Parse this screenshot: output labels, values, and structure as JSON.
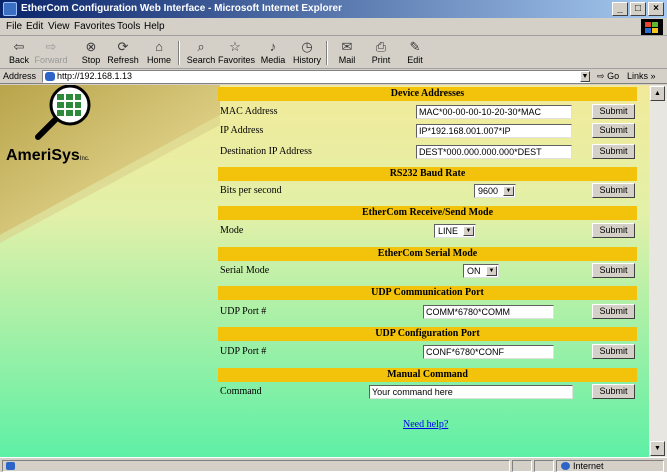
{
  "window": {
    "title": "EtherCom Configuration Web Interface - Microsoft Internet Explorer"
  },
  "menu": [
    "File",
    "Edit",
    "View",
    "Favorites",
    "Tools",
    "Help"
  ],
  "toolbar": {
    "back": "Back",
    "forward": "Forward",
    "stop": "Stop",
    "refresh": "Refresh",
    "home": "Home",
    "search": "Search",
    "favorites": "Favorites",
    "media": "Media",
    "history": "History",
    "mail": "Mail",
    "print": "Print",
    "edit": "Edit"
  },
  "address": {
    "label": "Address",
    "url": "http://192.168.1.13",
    "go": "Go",
    "links": "Links"
  },
  "logo": {
    "name": "AmeriSys",
    "suffix": "Inc."
  },
  "sections": {
    "device_addresses": "Device Addresses",
    "baud_rate": "RS232 Baud Rate",
    "rs_mode": "EtherCom Receive/Send Mode",
    "serial_mode": "EtherCom Serial Mode",
    "udp_comm": "UDP Communication Port",
    "udp_config": "UDP Configuration Port",
    "manual_cmd": "Manual Command"
  },
  "fields": {
    "mac": {
      "label": "MAC Address",
      "value": "MAC*00-00-00-10-20-30*MAC"
    },
    "ip": {
      "label": "IP Address",
      "value": "IP*192.168.001.007*IP"
    },
    "dest_ip": {
      "label": "Destination IP Address",
      "value": "DEST*000.000.000.000*DEST"
    },
    "bps": {
      "label": "Bits per second",
      "value": "9600"
    },
    "mode": {
      "label": "Mode",
      "value": "LINE"
    },
    "serial_mode": {
      "label": "Serial Mode",
      "value": "ON"
    },
    "udp_comm_port": {
      "label": "UDP Port #",
      "value": "COMM*6780*COMM"
    },
    "udp_conf_port": {
      "label": "UDP Port #",
      "value": "CONF*6780*CONF"
    },
    "command": {
      "label": "Command",
      "value": "Your command here"
    }
  },
  "submit_label": "Submit",
  "help_link": "Need help?",
  "status": {
    "zone": "Internet"
  },
  "colors": {
    "header_bg": "#f2c30a",
    "gradient_start": "#e8d96a",
    "gradient_end": "#6cf0a8",
    "link": "#0000ee",
    "title_bar": "#0a246a"
  }
}
